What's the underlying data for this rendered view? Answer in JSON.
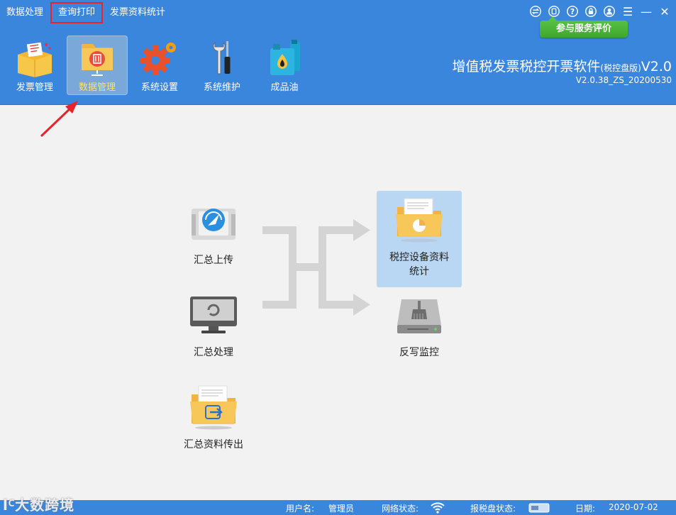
{
  "top_menu": [
    "数据处理",
    "查询打印",
    "发票资料统计"
  ],
  "feedback": "参与服务评价",
  "toolbar": [
    {
      "label": "发票管理",
      "icon": "invoice-box-icon"
    },
    {
      "label": "数据管理",
      "icon": "data-folder-icon"
    },
    {
      "label": "系统设置",
      "icon": "gear-icon"
    },
    {
      "label": "系统维护",
      "icon": "tools-icon"
    },
    {
      "label": "成品油",
      "icon": "oil-can-icon"
    }
  ],
  "app": {
    "title": "增值税发票税控开票软件",
    "edition": "(税控盘版)",
    "title_suffix": "V2.0",
    "version": "V2.0.38_ZS_20200530"
  },
  "functions": {
    "upload": "汇总上传",
    "process": "汇总处理",
    "export": "汇总资料传出",
    "stats_line1": "税控设备资料",
    "stats_line2": "统计",
    "monitor": "反写监控"
  },
  "status": {
    "user_label": "用户名:",
    "user": "管理员",
    "network_label": "网络状态:",
    "disk_label": "报税盘状态:",
    "date_label": "日期:",
    "date": "2020-07-02"
  },
  "watermark": "大数跨境",
  "colors": {
    "header": "#3a86dd",
    "accent_active": "#fde16a",
    "highlight": "#e8232a",
    "selected": "#b9d6f2"
  }
}
